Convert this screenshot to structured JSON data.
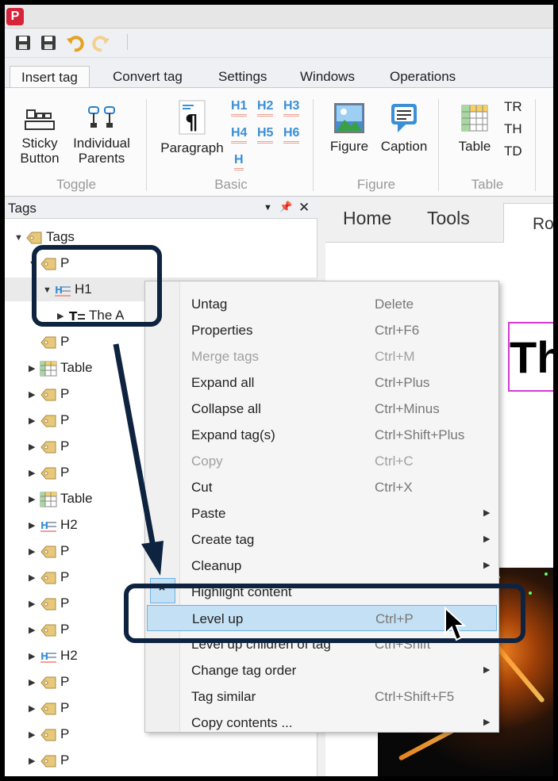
{
  "app": {
    "icon_letter": "P"
  },
  "ribbon": {
    "tabs": [
      "Insert tag",
      "Convert tag",
      "Settings",
      "Windows",
      "Operations"
    ],
    "toggle": {
      "sticky_line1": "Sticky",
      "sticky_line2": "Button",
      "parents_line1": "Individual",
      "parents_line2": "Parents",
      "group": "Toggle"
    },
    "basic": {
      "paragraph": "Paragraph",
      "h1": "H1",
      "h2": "H2",
      "h3": "H3",
      "h4": "H4",
      "h5": "H5",
      "h6": "H6",
      "h": "H",
      "group": "Basic"
    },
    "figure": {
      "figure": "Figure",
      "caption": "Caption",
      "group": "Figure"
    },
    "table": {
      "table": "Table",
      "tr": "TR",
      "th": "TH",
      "td": "TD",
      "group": "Table"
    }
  },
  "tags_panel": {
    "title": "Tags",
    "pin": "📌",
    "close": "✕",
    "dropdown": "▼",
    "rows": [
      {
        "label": "Tags"
      },
      {
        "label": "P"
      },
      {
        "label": "H1"
      },
      {
        "label": "The  A"
      },
      {
        "label": "P"
      },
      {
        "label": "Table"
      },
      {
        "label": "P"
      },
      {
        "label": "P"
      },
      {
        "label": "P"
      },
      {
        "label": "P"
      },
      {
        "label": "Table"
      },
      {
        "label": "H2"
      },
      {
        "label": "P"
      },
      {
        "label": "P"
      },
      {
        "label": "P"
      },
      {
        "label": "P"
      },
      {
        "label": "H2"
      },
      {
        "label": "P"
      },
      {
        "label": "P"
      },
      {
        "label": "P"
      },
      {
        "label": "P"
      }
    ]
  },
  "document": {
    "tabs": [
      "Home",
      "Tools",
      "Ro"
    ],
    "heading": "Th"
  },
  "context_menu": {
    "items": [
      {
        "label": "Untag",
        "key": "Delete"
      },
      {
        "label": "Properties",
        "key": "Ctrl+F6"
      },
      {
        "label": "Merge tags",
        "key": "Ctrl+M"
      },
      {
        "label": "Expand all",
        "key": "Ctrl+Plus"
      },
      {
        "label": "Collapse all",
        "key": "Ctrl+Minus"
      },
      {
        "label": "Expand tag(s)",
        "key": "Ctrl+Shift+Plus"
      },
      {
        "label": "Copy",
        "key": "Ctrl+C"
      },
      {
        "label": "Cut",
        "key": "Ctrl+X"
      },
      {
        "label": "Paste",
        "key": ""
      },
      {
        "label": "Create tag",
        "key": ""
      },
      {
        "label": "Cleanup",
        "key": ""
      },
      {
        "label": "Highlight content",
        "key": ""
      },
      {
        "label": "Level up",
        "key": "Ctrl+P"
      },
      {
        "label": "Level up children of tag",
        "key": "Ctrl+Shift"
      },
      {
        "label": "Change tag order",
        "key": ""
      },
      {
        "label": "Tag similar",
        "key": "Ctrl+Shift+F5"
      },
      {
        "label": "Copy contents ...",
        "key": ""
      }
    ]
  }
}
